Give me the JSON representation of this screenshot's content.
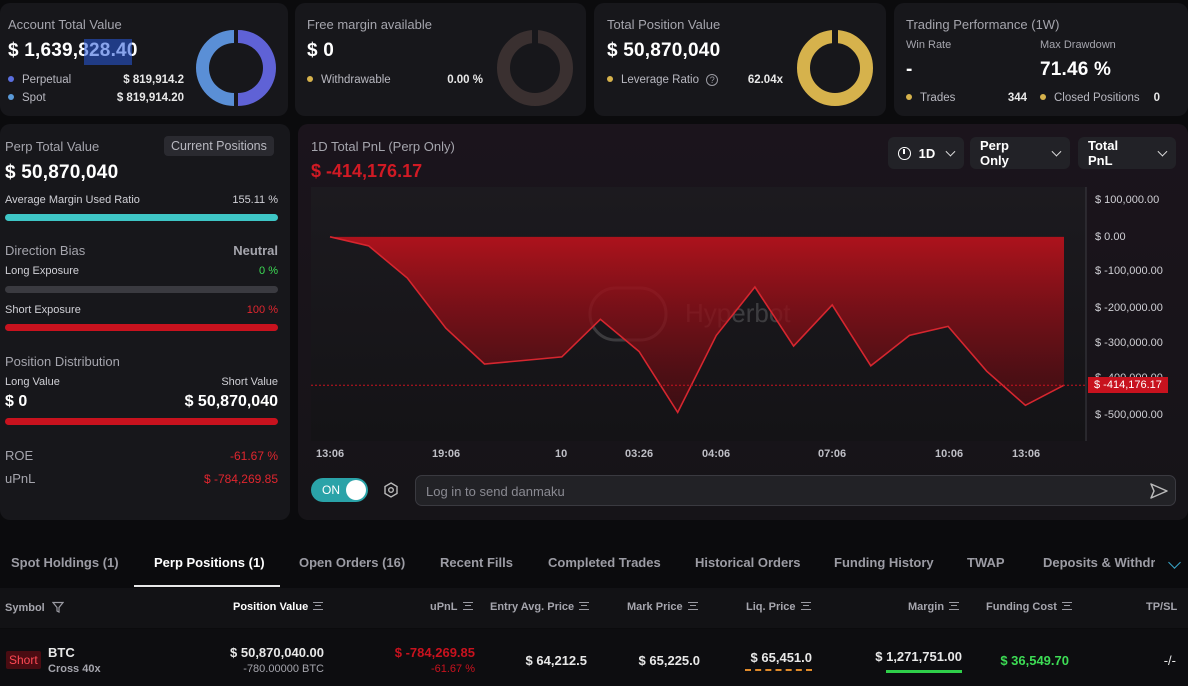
{
  "account": {
    "title": "Account Total Value",
    "value": "$ 1,639,828.40",
    "perpetual_label": "Perpetual",
    "perpetual_value": "$ 819,914.2",
    "spot_label": "Spot",
    "spot_value": "$ 819,914.20",
    "colors": {
      "perpetual": "#5b6fe0",
      "spot": "#5a9ad8"
    }
  },
  "free_margin": {
    "title": "Free margin available",
    "value": "$ 0",
    "withdrawable_label": "Withdrawable",
    "withdrawable_value": "0.00 %"
  },
  "position_value": {
    "title": "Total Position Value",
    "value": "$ 50,870,040",
    "leverage_label": "Leverage Ratio",
    "leverage_value": "62.04x",
    "color": "#d6b24c"
  },
  "performance": {
    "title": "Trading Performance (1W)",
    "win_rate_label": "Win Rate",
    "win_rate_value": "-",
    "max_drawdown_label": "Max Drawdown",
    "max_drawdown_value": "71.46 %",
    "trades_label": "Trades",
    "trades_value": "344",
    "closed_label": "Closed Positions",
    "closed_value": "0"
  },
  "perp": {
    "title": "Perp Total Value",
    "current_positions_btn": "Current Positions",
    "value": "$ 50,870,040",
    "margin_ratio_label": "Average Margin Used Ratio",
    "margin_ratio_value": "155.11 %",
    "margin_ratio_fill": 1.0,
    "direction_title": "Direction Bias",
    "direction_value": "Neutral",
    "long_label": "Long Exposure",
    "long_value": "0 %",
    "long_fill": 0.0,
    "short_label": "Short Exposure",
    "short_value": "100 %",
    "short_fill": 1.0,
    "distribution_title": "Position Distribution",
    "long_value_label": "Long Value",
    "short_value_label": "Short Value",
    "long_amount": "$ 0",
    "short_amount": "$ 50,870,040",
    "roe_label": "ROE",
    "roe_value": "-61.67 %",
    "upnl_label": "uPnL",
    "upnl_value": "$ -784,269.85"
  },
  "chart_panel": {
    "title": "1D Total PnL (Perp Only)",
    "value": "$ -414,176.17",
    "dropdowns": [
      "1D",
      "Perp Only",
      "Total PnL"
    ],
    "watermark": "Hyperbot",
    "toggle_label": "ON",
    "danmaku_placeholder": "Log in to send danmaku",
    "current_label": "$ -414,176.17"
  },
  "chart_data": {
    "type": "area",
    "title": "1D Total PnL (Perp Only)",
    "x_ticks": [
      "13:06",
      "19:06",
      "10",
      "03:26",
      "04:06",
      "07:06",
      "10:06",
      "13:06"
    ],
    "y_ticks": [
      "$ 100,000.00",
      "$ 0.00",
      "$ -100,000.00",
      "$ -200,000.00",
      "$ -300,000.00",
      "$ -400,000.00",
      "$ -500,000.00"
    ],
    "ylim": [
      -550000,
      130000
    ],
    "values": [
      0,
      -25000,
      -115000,
      -255000,
      -355000,
      -345000,
      -335000,
      -230000,
      -320000,
      -490000,
      -275000,
      -140000,
      -305000,
      -190000,
      -360000,
      -275000,
      -250000,
      -375000,
      -470000,
      -414176
    ],
    "current_value": -414176.17,
    "color": "#d11a24"
  },
  "tabs": [
    "Spot Holdings (1)",
    "Perp Positions (1)",
    "Open Orders (16)",
    "Recent Fills",
    "Completed Trades",
    "Historical Orders",
    "Funding History",
    "TWAP",
    "Deposits & Withdra"
  ],
  "active_tab": 1,
  "table": {
    "headers": {
      "symbol": "Symbol",
      "position_value": "Position Value",
      "upnl": "uPnL",
      "entry": "Entry Avg. Price",
      "mark": "Mark Price",
      "liq": "Liq. Price",
      "margin": "Margin",
      "funding": "Funding Cost",
      "tpsl": "TP/SL"
    },
    "row": {
      "side": "Short",
      "symbol": "BTC",
      "margin_mode": "Cross 40x",
      "position_value": "$ 50,870,040.00",
      "position_size": "-780.00000 BTC",
      "upnl": "$ -784,269.85",
      "upnl_pct": "-61.67 %",
      "entry": "$ 64,212.5",
      "mark": "$ 65,225.0",
      "liq": "$ 65,451.0",
      "margin": "$ 1,271,751.00",
      "funding": "$ 36,549.70",
      "tpsl": "-/-"
    }
  }
}
